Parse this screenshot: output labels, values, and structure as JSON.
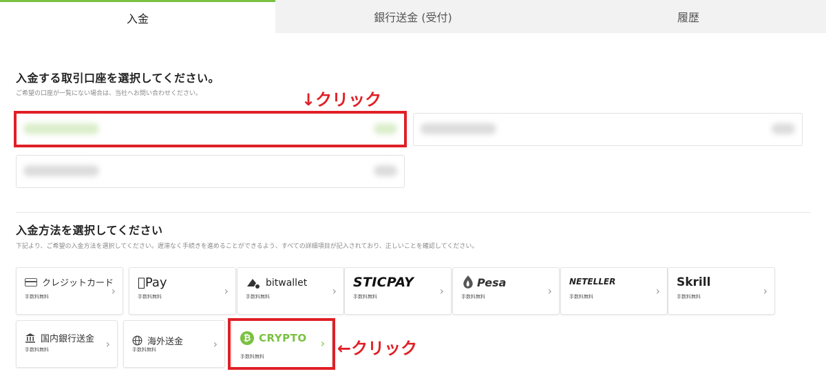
{
  "tabs": [
    {
      "label": "入金"
    },
    {
      "label": "銀行送金 (受付)"
    },
    {
      "label": "履歴"
    }
  ],
  "account_section": {
    "title": "入金する取引口座を選択してください。",
    "description": "ご希望の口座が一覧にない場合は、当社へお問い合わせください。"
  },
  "method_section": {
    "title": "入金方法を選択してください",
    "description": "下記より、ご希望の入金方法を選択してください。遅滞なく手続きを進めることができるよう、すべての詳細項目が記入されており、正しいことを確認してください。"
  },
  "methods": [
    {
      "label": "クレジットカード",
      "fee": "手数料無料",
      "icon": "credit-card-icon"
    },
    {
      "label": "Pay",
      "fee": "手数料無料",
      "icon": "apple-icon"
    },
    {
      "label": "bitwallet",
      "fee": "手数料無料",
      "icon": "bitwallet-icon"
    },
    {
      "label": "STICPAY",
      "fee": "手数料無料"
    },
    {
      "label": "Pesa",
      "fee": "手数料無料",
      "icon": "pesa-icon"
    },
    {
      "label": "NETELLER",
      "fee": "手数料無料"
    },
    {
      "label": "Skrill",
      "fee": "手数料無料"
    },
    {
      "label": "国内銀行送金",
      "fee": "手数料無料",
      "icon": "bank-icon"
    },
    {
      "label": "海外送金",
      "fee": "手数料無料",
      "icon": "globe-icon"
    },
    {
      "label": "CRYPTO",
      "fee": "手数料無料",
      "icon": "bitcoin-icon"
    }
  ],
  "annotations": {
    "top": "↓クリック",
    "side": "←クリック"
  },
  "colors": {
    "accent": "#7ac142",
    "highlight": "#e01f26"
  }
}
